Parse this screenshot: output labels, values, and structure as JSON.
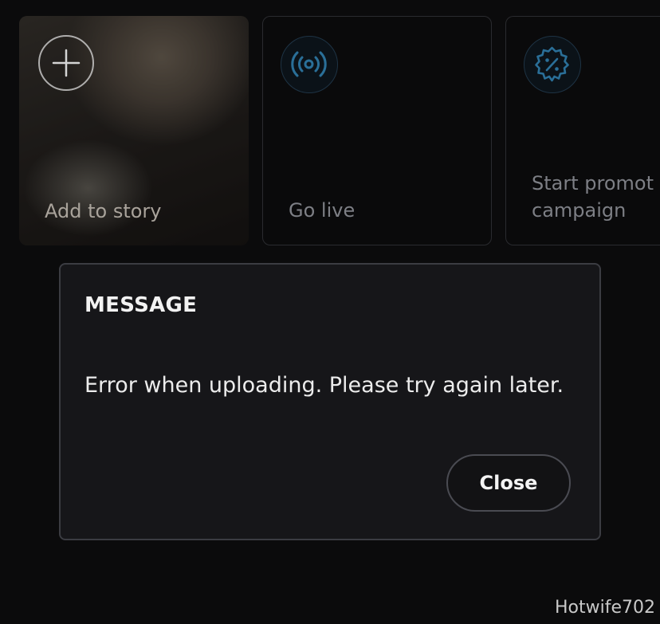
{
  "cards": [
    {
      "label": "Add to story",
      "icon": "plus-icon"
    },
    {
      "label": "Go live",
      "icon": "broadcast-icon"
    },
    {
      "label": "Start promot\ncampaign",
      "icon": "discount-badge-icon"
    }
  ],
  "dialog": {
    "title": "MESSAGE",
    "message": "Error when uploading. Please try again later.",
    "close_label": "Close"
  },
  "watermark": "Hotwife702",
  "colors": {
    "background": "#0b0b0c",
    "dialog_bg": "#161619",
    "dialog_border": "#3b3c42",
    "icon_accent": "#2a6f98",
    "card_label": "#7d7f85"
  }
}
